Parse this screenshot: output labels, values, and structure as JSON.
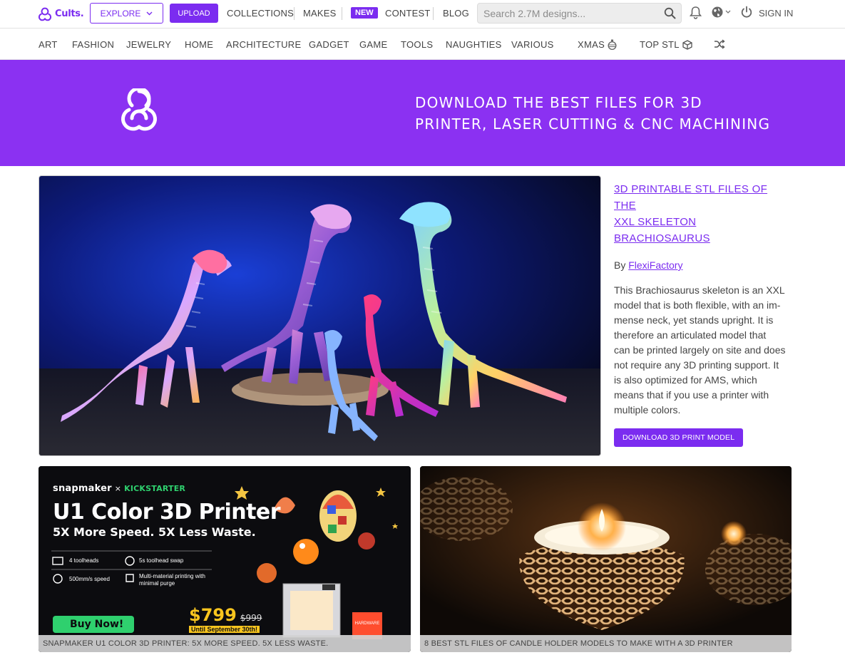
{
  "brand": {
    "name": "Cults.",
    "accent": "#7b2cf0",
    "hero_bg": "#8b31f2"
  },
  "topbar": {
    "explore_label": "EXPLORE",
    "upload_label": "UPLOAD",
    "links": {
      "collections": "COLLECTIONS",
      "makes": "MAKES",
      "new_badge": "NEW",
      "contest": "CONTEST",
      "blog": "BLOG"
    },
    "search_placeholder": "Search 2.7M designs...",
    "signin_label": "SIGN IN"
  },
  "categories": [
    "ART",
    "FASHION",
    "JEWELRY",
    "HOME",
    "ARCHITECTURE",
    "GADGET",
    "GAME",
    "TOOLS",
    "NAUGHTIES",
    "VARIOUS",
    "XMAS",
    "TOP STL"
  ],
  "hero": {
    "line1": "DOWNLOAD THE BEST FILES FOR 3D",
    "line2": "PRINTER, LASER CUTTING & CNC MACHINING"
  },
  "featured": {
    "title_line1": "3D PRINTABLE STL FILES OF THE",
    "title_line2": "XXL SKELETON BRACHIOSAURUS",
    "by_prefix": "By",
    "author": "FlexiFactory",
    "desc": [
      "This Brachiosaurus skeleton is an XXL",
      "model that is both flexible, with an im-",
      "mense neck, yet stands upright. It is",
      "therefore an articulated model that",
      "can be printed largely on site and does",
      "not require any 3D printing support. It",
      "is also optimized for AMS, which",
      "means that if you use a printer with",
      "multiple colors."
    ],
    "download_label": "DOWNLOAD 3D PRINT MODEL"
  },
  "ad": {
    "brand": "snapmaker",
    "cross": "×",
    "partner": "KICKSTARTER",
    "headline": "U1 Color 3D Printer",
    "tagline": "5X More Speed. 5X Less Waste.",
    "feature1": "4 toolheads",
    "feature2": "5s toolhead swap",
    "feature3": "500mm/s speed",
    "feature4a": "Multi-material printing with",
    "feature4b": "minimal purge",
    "cta": "Buy Now!",
    "price": "$799",
    "old_price": "$999",
    "until": "Until September 30th!",
    "caption": "SNAPMAKER U1 COLOR 3D PRINTER: 5X MORE SPEED. 5X LESS WASTE."
  },
  "candle_card": {
    "caption": "8 BEST STL FILES OF CANDLE HOLDER MODELS TO MAKE WITH A 3D PRINTER"
  }
}
